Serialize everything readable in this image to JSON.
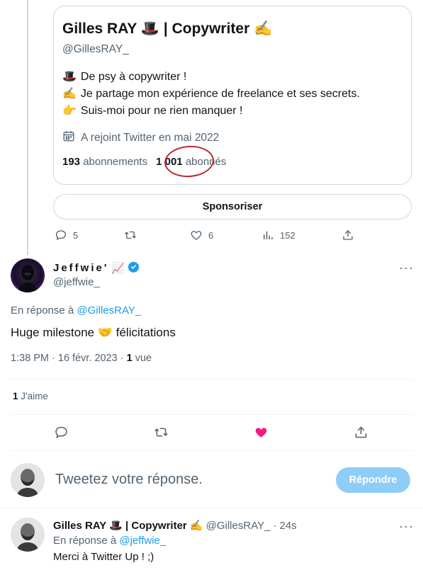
{
  "card": {
    "name": "Gilles RAY 🎩 | Copywriter ✍️",
    "handle": "@GillesRAY_",
    "bio": [
      {
        "emoji": "🎩",
        "text": "De psy à copywriter !"
      },
      {
        "emoji": "✍️",
        "text": "Je partage mon expérience de freelance et ses secrets."
      },
      {
        "emoji": "👉",
        "text": "Suis-moi pour ne rien manquer !"
      }
    ],
    "joined": "A rejoint Twitter en mai 2022",
    "following_count": "193",
    "following_label": "abonnements",
    "followers_count": "1 001",
    "followers_label": "abonnés"
  },
  "sponsor_label": "Sponsoriser",
  "tweet_actions": {
    "replies": "5",
    "likes": "6",
    "views": "152"
  },
  "reply_tweet": {
    "name": "Jeffwie'",
    "name_emoji": "📈",
    "handle": "@jeffwie_",
    "in_reply_prefix": "En réponse à",
    "in_reply_handle": "@GillesRAY_",
    "text": "Huge milestone 🤝 félicitations",
    "timestamp": "1:38 PM · 16 févr. 2023 · ",
    "views_count": "1",
    "views_label": "vue",
    "likes_count": "1",
    "likes_label": "J'aime",
    "more": "···"
  },
  "compose": {
    "placeholder": "Tweetez votre réponse.",
    "button": "Répondre"
  },
  "bottom_tweet": {
    "name": "Gilles RAY 🎩 | Copywriter ✍️",
    "handle": "@GillesRAY_",
    "separator": "·",
    "time": "24s",
    "in_reply_prefix": "En réponse à",
    "in_reply_handle": "@jeffwie_",
    "text": "Merci à Twitter Up ! ;)",
    "more": "···"
  },
  "colors": {
    "accent": "#1d9bf0",
    "like_active": "#f91880",
    "annotation_circle": "#c0282d",
    "reply_button_disabled": "#8ecdf7"
  }
}
